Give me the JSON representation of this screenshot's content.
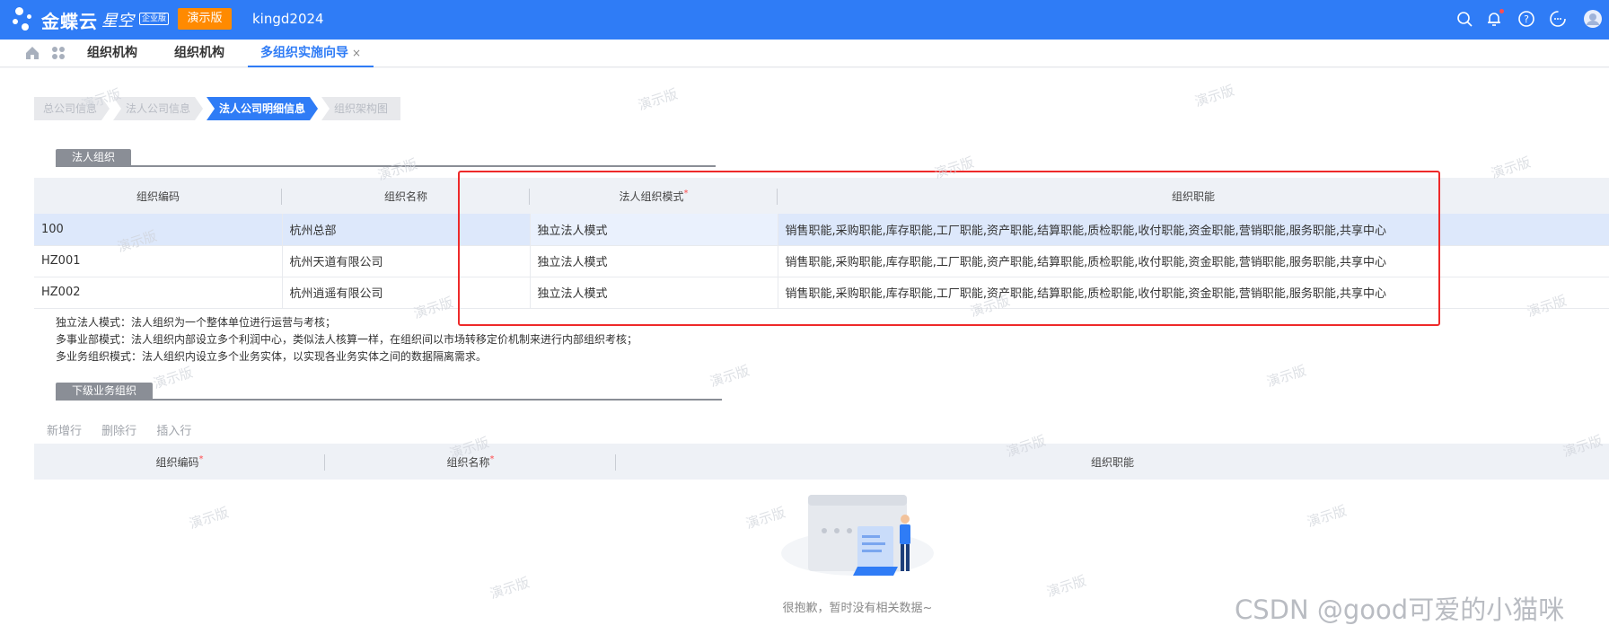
{
  "header": {
    "brand": "金蝶云",
    "product": "星空",
    "edition_badge": "企业版",
    "demo_label": "演示版",
    "user": "kingd2024"
  },
  "tabs": [
    {
      "label": "组织机构"
    },
    {
      "label": "组织机构"
    },
    {
      "label": "多组织实施向导",
      "close": "×"
    }
  ],
  "steps": [
    "总公司信息",
    "法人公司信息",
    "法人公司明细信息",
    "组织架构图"
  ],
  "legal_section": {
    "title": "法人组织",
    "columns": [
      "组织编码",
      "组织名称",
      "法人组织模式",
      "组织职能"
    ],
    "required_mark": "*",
    "rows": [
      {
        "code": "100",
        "name": "杭州总部",
        "mode": "独立法人模式",
        "functions": "销售职能,采购职能,库存职能,工厂职能,资产职能,结算职能,质检职能,收付职能,资金职能,营销职能,服务职能,共享中心"
      },
      {
        "code": "HZ001",
        "name": "杭州天道有限公司",
        "mode": "独立法人模式",
        "functions": "销售职能,采购职能,库存职能,工厂职能,资产职能,结算职能,质检职能,收付职能,资金职能,营销职能,服务职能,共享中心"
      },
      {
        "code": "HZ002",
        "name": "杭州逍遥有限公司",
        "mode": "独立法人模式",
        "functions": "销售职能,采购职能,库存职能,工厂职能,资产职能,结算职能,质检职能,收付职能,资金职能,营销职能,服务职能,共享中心"
      }
    ]
  },
  "notes": [
    "独立法人模式：法人组织为一个整体单位进行运营与考核；",
    "多事业部模式：法人组织内部设立多个利润中心，类似法人核算一样，在组织间以市场转移定价机制来进行内部组织考核；",
    "多业务组织模式：法人组织内设立多个业务实体，以实现各业务实体之间的数据隔离需求。"
  ],
  "sub_section": {
    "title": "下级业务组织",
    "toolbar": [
      "新增行",
      "删除行",
      "插入行"
    ],
    "columns": [
      "组织编码",
      "组织名称",
      "组织职能"
    ],
    "empty_text": "很抱歉，暂时没有相关数据~"
  },
  "watermark_text": "演示版",
  "footer_watermark": "CSDN @good可爱的小猫咪",
  "colors": {
    "primary": "#2f7cf6",
    "demo": "#ff8a00",
    "highlight": "#ee2a2a"
  }
}
